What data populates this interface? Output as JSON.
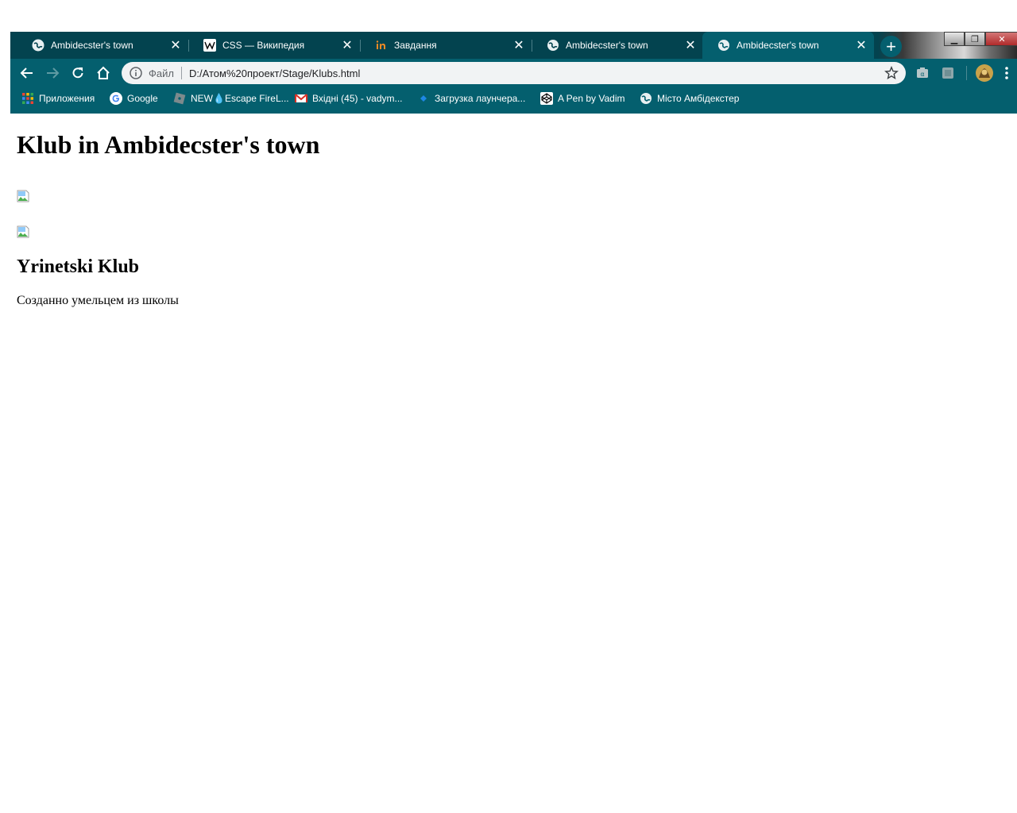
{
  "browser": {
    "tabs": [
      {
        "title": "Ambidecster's town",
        "icon": "globe-icon",
        "active": false
      },
      {
        "title": "CSS — Википедия",
        "icon": "wikipedia-icon",
        "active": false
      },
      {
        "title": "Завдання",
        "icon": "invision-icon",
        "active": false
      },
      {
        "title": "Ambidecster's town",
        "icon": "globe-icon",
        "active": false
      },
      {
        "title": "Ambidecster's town",
        "icon": "globe-icon",
        "active": true
      }
    ],
    "tab_close_glyph": "✕",
    "new_tab_glyph": "+",
    "window_controls": {
      "minimize": "▁",
      "restore": "❐",
      "close": "✕"
    },
    "address_bar": {
      "scheme_label": "Файл",
      "url": "D:/Атом%20проект/Stage/Klubs.html"
    },
    "bookmarks": [
      {
        "label": "Приложения",
        "icon": "apps-grid-icon"
      },
      {
        "label": "Google",
        "icon": "google-icon"
      },
      {
        "label": "NEW💧Escape FireL...",
        "icon": "roblox-icon"
      },
      {
        "label": "Вхідні (45) - vadym...",
        "icon": "gmail-icon"
      },
      {
        "label": "Загрузка лаунчера...",
        "icon": "diamond-icon"
      },
      {
        "label": "A Pen by Vadim",
        "icon": "codepen-icon"
      },
      {
        "label": "Місто Амбідекстер",
        "icon": "globe-icon"
      }
    ],
    "colors": {
      "tabstrip": "#03434f",
      "toolbar": "#045f6e",
      "omnibox": "#f1f3f4"
    }
  },
  "page": {
    "heading": "Klub in Ambidecster's town",
    "subheading": "Yrinetski Klub",
    "paragraph": "Созданно умельцем из школы"
  }
}
